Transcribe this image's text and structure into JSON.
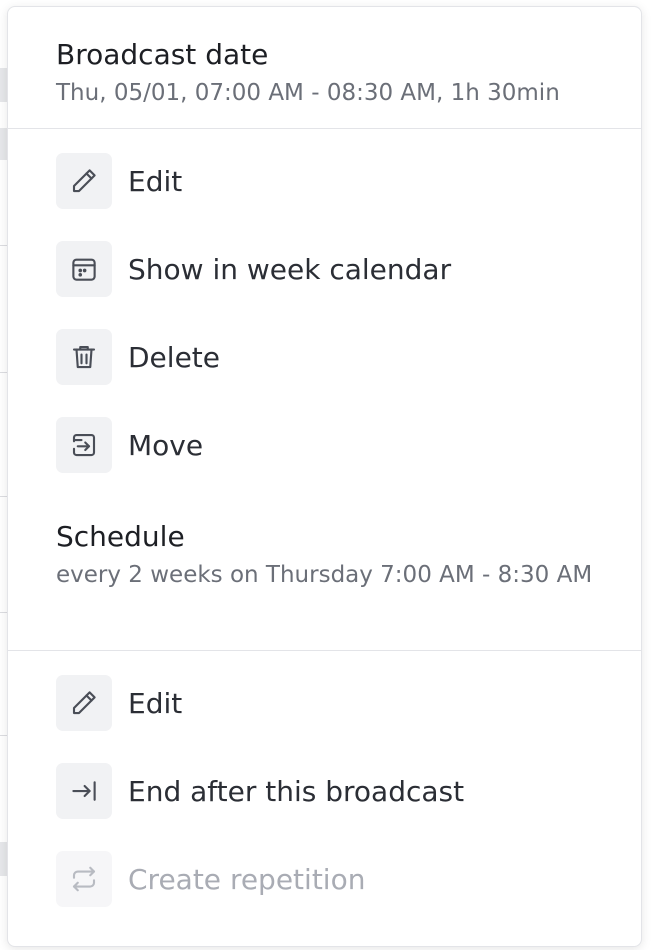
{
  "broadcast": {
    "title": "Broadcast date",
    "subtitle": "Thu, 05/01, 07:00 AM - 08:30 AM, 1h 30min",
    "items": [
      {
        "label": "Edit",
        "icon": "pencil-icon"
      },
      {
        "label": "Show in week calendar",
        "icon": "calendar-icon"
      },
      {
        "label": "Delete",
        "icon": "trash-icon"
      },
      {
        "label": "Move",
        "icon": "move-icon"
      }
    ]
  },
  "schedule": {
    "title": "Schedule",
    "subtitle": "every 2 weeks on Thursday 7:00 AM - 8:30 AM",
    "items": [
      {
        "label": "Edit",
        "icon": "pencil-icon"
      },
      {
        "label": "End after this broadcast",
        "icon": "arrow-to-end-icon"
      },
      {
        "label": "Create repetition",
        "icon": "repeat-icon",
        "disabled": true
      }
    ]
  },
  "colors": {
    "text_primary": "#1d1f24",
    "text_secondary": "#6b6f78",
    "text_disabled": "#a9acb4",
    "icon_background": "#f1f2f4",
    "divider": "#e3e4e8"
  }
}
